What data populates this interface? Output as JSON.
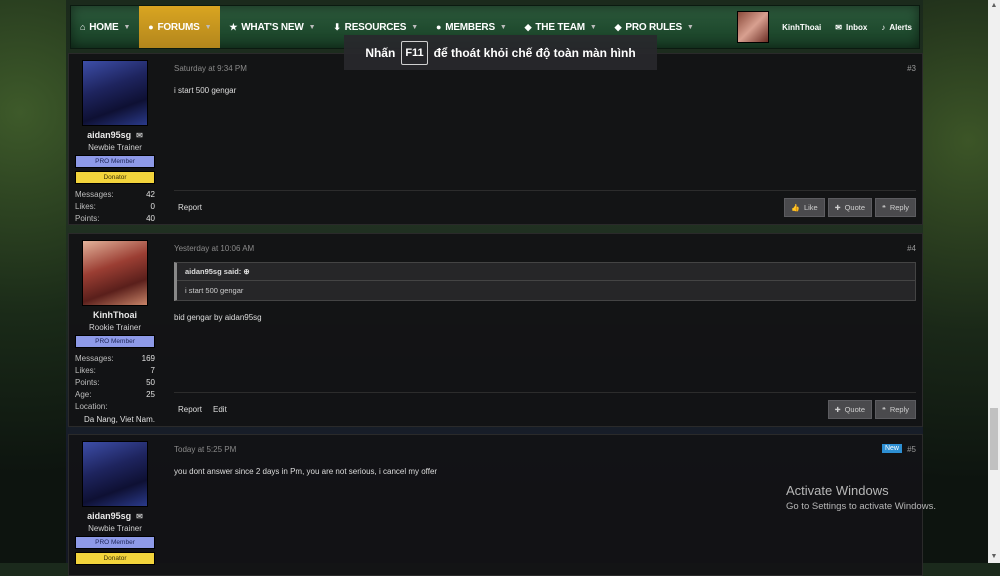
{
  "nav": {
    "items": [
      {
        "label": "HOME",
        "icon": "home-icon",
        "glyph": "⌂"
      },
      {
        "label": "FORUMS",
        "icon": "chat-icon",
        "glyph": "●"
      },
      {
        "label": "WHAT'S NEW",
        "icon": "star-icon",
        "glyph": "★"
      },
      {
        "label": "RESOURCES",
        "icon": "download-icon",
        "glyph": "⬇"
      },
      {
        "label": "MEMBERS",
        "icon": "user-icon",
        "glyph": "●"
      },
      {
        "label": "THE TEAM",
        "icon": "tag-icon",
        "glyph": "◆"
      },
      {
        "label": "PRO RULES",
        "icon": "tag-icon",
        "glyph": "◆"
      }
    ],
    "username": "KinhThoai",
    "inbox": "Inbox",
    "alerts": "Alerts"
  },
  "fullscreen": {
    "before": "Nhấn",
    "key": "F11",
    "after": "để thoát khỏi chế độ toàn màn hình"
  },
  "posts": [
    {
      "user": "aidan95sg",
      "title": "Newbie Trainer",
      "badge1": "PRO Member",
      "badge2": "Donator",
      "stats": {
        "messages_label": "Messages:",
        "messages": "42",
        "likes_label": "Likes:",
        "likes": "0",
        "points_label": "Points:",
        "points": "40"
      },
      "date": "Saturday at 9:34 PM",
      "num": "#3",
      "text": "i start 500 gengar",
      "report": "Report",
      "like": "Like",
      "quote": "Quote",
      "reply": "Reply"
    },
    {
      "user": "KinhThoai",
      "title": "Rookie Trainer",
      "badge1": "PRO Member",
      "stats": {
        "messages_label": "Messages:",
        "messages": "169",
        "likes_label": "Likes:",
        "likes": "7",
        "points_label": "Points:",
        "points": "50",
        "age_label": "Age:",
        "age": "25",
        "location_label": "Location:",
        "location": "Da Nang, Viet Nam."
      },
      "date": "Yesterday at 10:06 AM",
      "num": "#4",
      "quote_author": "aidan95sg said:",
      "quote_text": "i start 500 gengar",
      "text": "bid gengar by aidan95sg",
      "report": "Report",
      "edit": "Edit",
      "quote": "Quote",
      "reply": "Reply"
    },
    {
      "user": "aidan95sg",
      "title": "Newbie Trainer",
      "badge1": "PRO Member",
      "badge2": "Donator",
      "date": "Today at 5:25 PM",
      "new": "New",
      "num": "#5",
      "text": "you dont answer since 2 days in Pm, you are not serious, i cancel my offer"
    }
  ],
  "watermark": {
    "line1": "Activate Windows",
    "line2": "Go to Settings to activate Windows."
  }
}
